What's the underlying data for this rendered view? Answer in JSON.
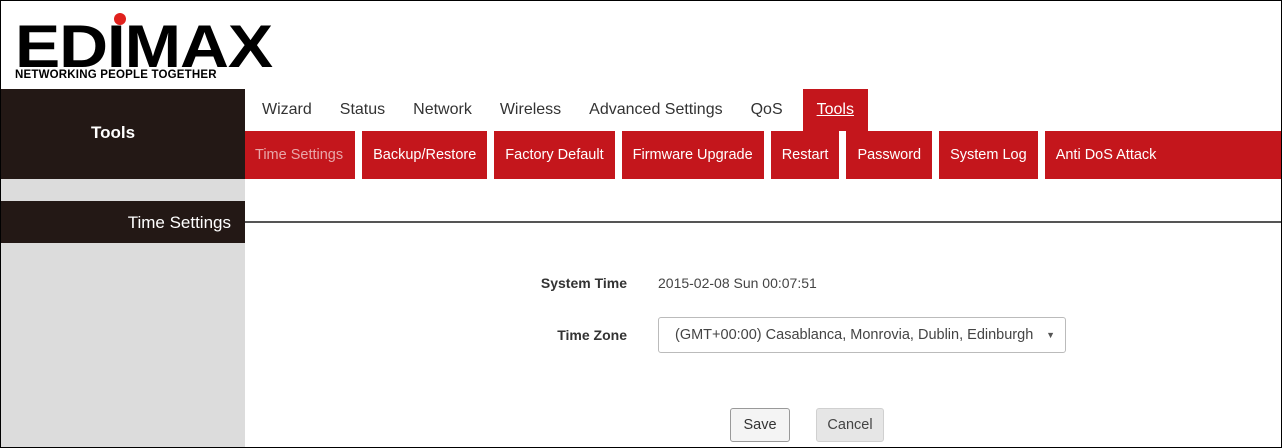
{
  "brand": {
    "logo_text": "EDIMAX",
    "tagline": "NETWORKING PEOPLE TOGETHER",
    "accent": "#e0211d"
  },
  "sidebar": {
    "title": "Tools",
    "section": "Time Settings"
  },
  "topnav": {
    "tabs": [
      "Wizard",
      "Status",
      "Network",
      "Wireless",
      "Advanced Settings",
      "QoS",
      "Tools"
    ],
    "active": "Tools"
  },
  "subnav": {
    "items": [
      "Time Settings",
      "Backup/Restore",
      "Factory Default",
      "Firmware Upgrade",
      "Restart",
      "Password",
      "System Log",
      "Anti DoS Attack"
    ],
    "current": "Time Settings"
  },
  "form": {
    "system_time_label": "System Time",
    "system_time_value": "2015-02-08 Sun 00:07:51",
    "time_zone_label": "Time Zone",
    "time_zone_value": "(GMT+00:00) Casablanca, Monrovia, Dublin, Edinburgh",
    "save_label": "Save",
    "cancel_label": "Cancel"
  },
  "colors": {
    "nav_red": "#c4161c",
    "panel_dark": "#231815",
    "panel_gray": "#dcdcdc"
  }
}
